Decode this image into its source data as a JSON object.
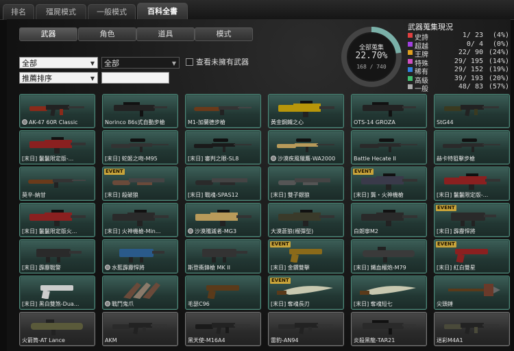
{
  "top_tabs": [
    "排名",
    "殭屍模式",
    "一般模式",
    "百科全書"
  ],
  "sub_tabs": [
    "武器",
    "角色",
    "道具",
    "模式"
  ],
  "filters": {
    "category": "全部",
    "subcategory": "全部",
    "sort": "推薦排序",
    "search_value": "",
    "unowned_label": "查看未擁有武器"
  },
  "collection": {
    "ring_label": "全部蒐集",
    "percent": "22.70%",
    "count": "168 / 740",
    "fraction": 0.227
  },
  "stats": {
    "title": "武器蒐集現況",
    "rows": [
      {
        "name": "史詩",
        "count": "1/  23",
        "pct": "(4%)",
        "color": "#e04040"
      },
      {
        "name": "超越",
        "count": "0/   4",
        "pct": "(0%)",
        "color": "#a040e0"
      },
      {
        "name": "王牌",
        "count": "22/  90",
        "pct": "(24%)",
        "color": "#e0a020"
      },
      {
        "name": "特殊",
        "count": "29/ 195",
        "pct": "(14%)",
        "color": "#d050c0"
      },
      {
        "name": "稀有",
        "count": "29/ 152",
        "pct": "(19%)",
        "color": "#3080e0"
      },
      {
        "name": "高級",
        "count": "39/ 193",
        "pct": "(20%)",
        "color": "#40c070"
      },
      {
        "name": "一般",
        "count": "48/  83",
        "pct": "(57%)",
        "color": "#aaaaaa"
      }
    ]
  },
  "weapons": [
    {
      "name": "AK-47 60R Classic",
      "owned_icon": true,
      "event": "",
      "color": "#8a2a1a",
      "shape": "rifle"
    },
    {
      "name": "Norinco 86s式自動步槍",
      "owned_icon": false,
      "event": "",
      "color": "#222222",
      "shape": "bullpup"
    },
    {
      "name": "M1-加蘭德步槍",
      "owned_icon": false,
      "event": "",
      "color": "#6a3a1a",
      "shape": "long"
    },
    {
      "name": "黃金鋼鐵之心",
      "owned_icon": false,
      "event": "",
      "color": "#b8960a",
      "shape": "heavy"
    },
    {
      "name": "OTS-14 GROZA",
      "owned_icon": false,
      "event": "",
      "color": "#222222",
      "shape": "bullpup"
    },
    {
      "name": "StG44",
      "owned_icon": false,
      "event": "",
      "color": "#3a3a20",
      "shape": "rifle"
    },
    {
      "name": "[末日] 鬣鬣限定版-...",
      "owned_icon": false,
      "event": "",
      "color": "#8a2020",
      "shape": "heavy"
    },
    {
      "name": "[末日] 蛇姬之吻-M95",
      "owned_icon": false,
      "event": "",
      "color": "#333333",
      "shape": "sniper"
    },
    {
      "name": "[末日] 審判之眼-SL8",
      "owned_icon": false,
      "event": "",
      "color": "#1a1a1a",
      "shape": "sniper"
    },
    {
      "name": "沙漠疾風獵鷹-WA2000",
      "owned_icon": true,
      "event": "",
      "color": "#b89a5a",
      "shape": "sniper"
    },
    {
      "name": "Battle Hecate II",
      "owned_icon": false,
      "event": "",
      "color": "#2a2a2a",
      "shape": "sniper"
    },
    {
      "name": "赫卡特狙擊步槍",
      "owned_icon": false,
      "event": "",
      "color": "#2a2a2a",
      "shape": "sniper"
    },
    {
      "name": "莫辛-納甘",
      "owned_icon": false,
      "event": "",
      "color": "#6a3a1a",
      "shape": "long"
    },
    {
      "name": "[末日] 殺破狼",
      "owned_icon": false,
      "event": "EVENT",
      "color": "#6a4a3a",
      "shape": "shotgun"
    },
    {
      "name": "[末日] 戰魂-SPAS12",
      "owned_icon": false,
      "event": "",
      "color": "#2a2a2a",
      "shape": "shotgun"
    },
    {
      "name": "[末日] 雙子銀狼",
      "owned_icon": false,
      "event": "",
      "color": "#555555",
      "shape": "shotgun"
    },
    {
      "name": "[末日] 龔・火神機槍",
      "owned_icon": false,
      "event": "EVENT",
      "color": "#3a3a4a",
      "shape": "heavy"
    },
    {
      "name": "[末日] 鬣鬣限定版-...",
      "owned_icon": false,
      "event": "",
      "color": "#8a2020",
      "shape": "heavy"
    },
    {
      "name": "[末日] 鬣鬣限定版火...",
      "owned_icon": false,
      "event": "",
      "color": "#8a2020",
      "shape": "heavy"
    },
    {
      "name": "[末日] 火神機槍-Min...",
      "owned_icon": false,
      "event": "",
      "color": "#2a2a2a",
      "shape": "heavy"
    },
    {
      "name": "沙漠殲滅者-MG3",
      "owned_icon": true,
      "event": "",
      "color": "#b89a5a",
      "shape": "heavy"
    },
    {
      "name": "大漠蒼狼(榴彈型)",
      "owned_icon": false,
      "event": "",
      "color": "#3a3a2a",
      "shape": "heavy"
    },
    {
      "name": "白朗寧M2",
      "owned_icon": false,
      "event": "",
      "color": "#2a2a2a",
      "shape": "heavy"
    },
    {
      "name": "[末日] 霹靂悍將",
      "owned_icon": false,
      "event": "EVENT",
      "color": "#2a2a2a",
      "shape": "smg"
    },
    {
      "name": "[末日] 霹靂戰警",
      "owned_icon": false,
      "event": "",
      "color": "#2a2a2a",
      "shape": "smg"
    },
    {
      "name": "水藍霹靂悍將",
      "owned_icon": true,
      "event": "",
      "color": "#2a5a8a",
      "shape": "smg"
    },
    {
      "name": "斯登衝鋒槍 MK II",
      "owned_icon": false,
      "event": "",
      "color": "#333333",
      "shape": "smg"
    },
    {
      "name": "[末日] 金鑽雙擊",
      "owned_icon": false,
      "event": "EVENT",
      "color": "#8a6a1a",
      "shape": "pistol"
    },
    {
      "name": "[末日] 鐵血榴炮-M79",
      "owned_icon": false,
      "event": "",
      "color": "#3a3a3a",
      "shape": "launcher"
    },
    {
      "name": "[末日] 紅白雙星",
      "owned_icon": false,
      "event": "EVENT",
      "color": "#8a2020",
      "shape": "pistol"
    },
    {
      "name": "[末日] 黑白雙煞-Dua...",
      "owned_icon": false,
      "event": "",
      "color": "#cccccc",
      "shape": "pistol"
    },
    {
      "name": "戰鬥鬼爪",
      "owned_icon": true,
      "event": "",
      "color": "#6a4a3a",
      "shape": "claw"
    },
    {
      "name": "毛瑟C96",
      "owned_icon": false,
      "event": "",
      "color": "#5a3a1a",
      "shape": "pistol"
    },
    {
      "name": "[末日] 奪魂長刃",
      "owned_icon": false,
      "event": "EVENT",
      "color": "#c8c8b0",
      "shape": "blade"
    },
    {
      "name": "[末日] 奪魂短七",
      "owned_icon": false,
      "event": "",
      "color": "#c8c8b0",
      "shape": "blade"
    },
    {
      "name": "尖頭錘",
      "owned_icon": false,
      "event": "",
      "color": "#6a3a2a",
      "shape": "hammer"
    },
    {
      "name": "火箭筒-AT Lance",
      "owned_icon": false,
      "event": "",
      "color": "#5a5a3a",
      "shape": "launcher",
      "gray": true
    },
    {
      "name": "AKM",
      "owned_icon": false,
      "event": "",
      "color": "#2a2a2a",
      "shape": "rifle",
      "gray": true
    },
    {
      "name": "黑天使-M16A4",
      "owned_icon": false,
      "event": "",
      "color": "#1a1a1a",
      "shape": "rifle",
      "gray": true
    },
    {
      "name": "雷豹-AN94",
      "owned_icon": false,
      "event": "",
      "color": "#2a2a2a",
      "shape": "rifle",
      "gray": true
    },
    {
      "name": "炎殺黑龍-TAR21",
      "owned_icon": false,
      "event": "",
      "color": "#2a2a2a",
      "shape": "bullpup",
      "gray": true
    },
    {
      "name": "迷彩M4A1",
      "owned_icon": false,
      "event": "",
      "color": "#4a4a3a",
      "shape": "rifle",
      "gray": true
    }
  ]
}
